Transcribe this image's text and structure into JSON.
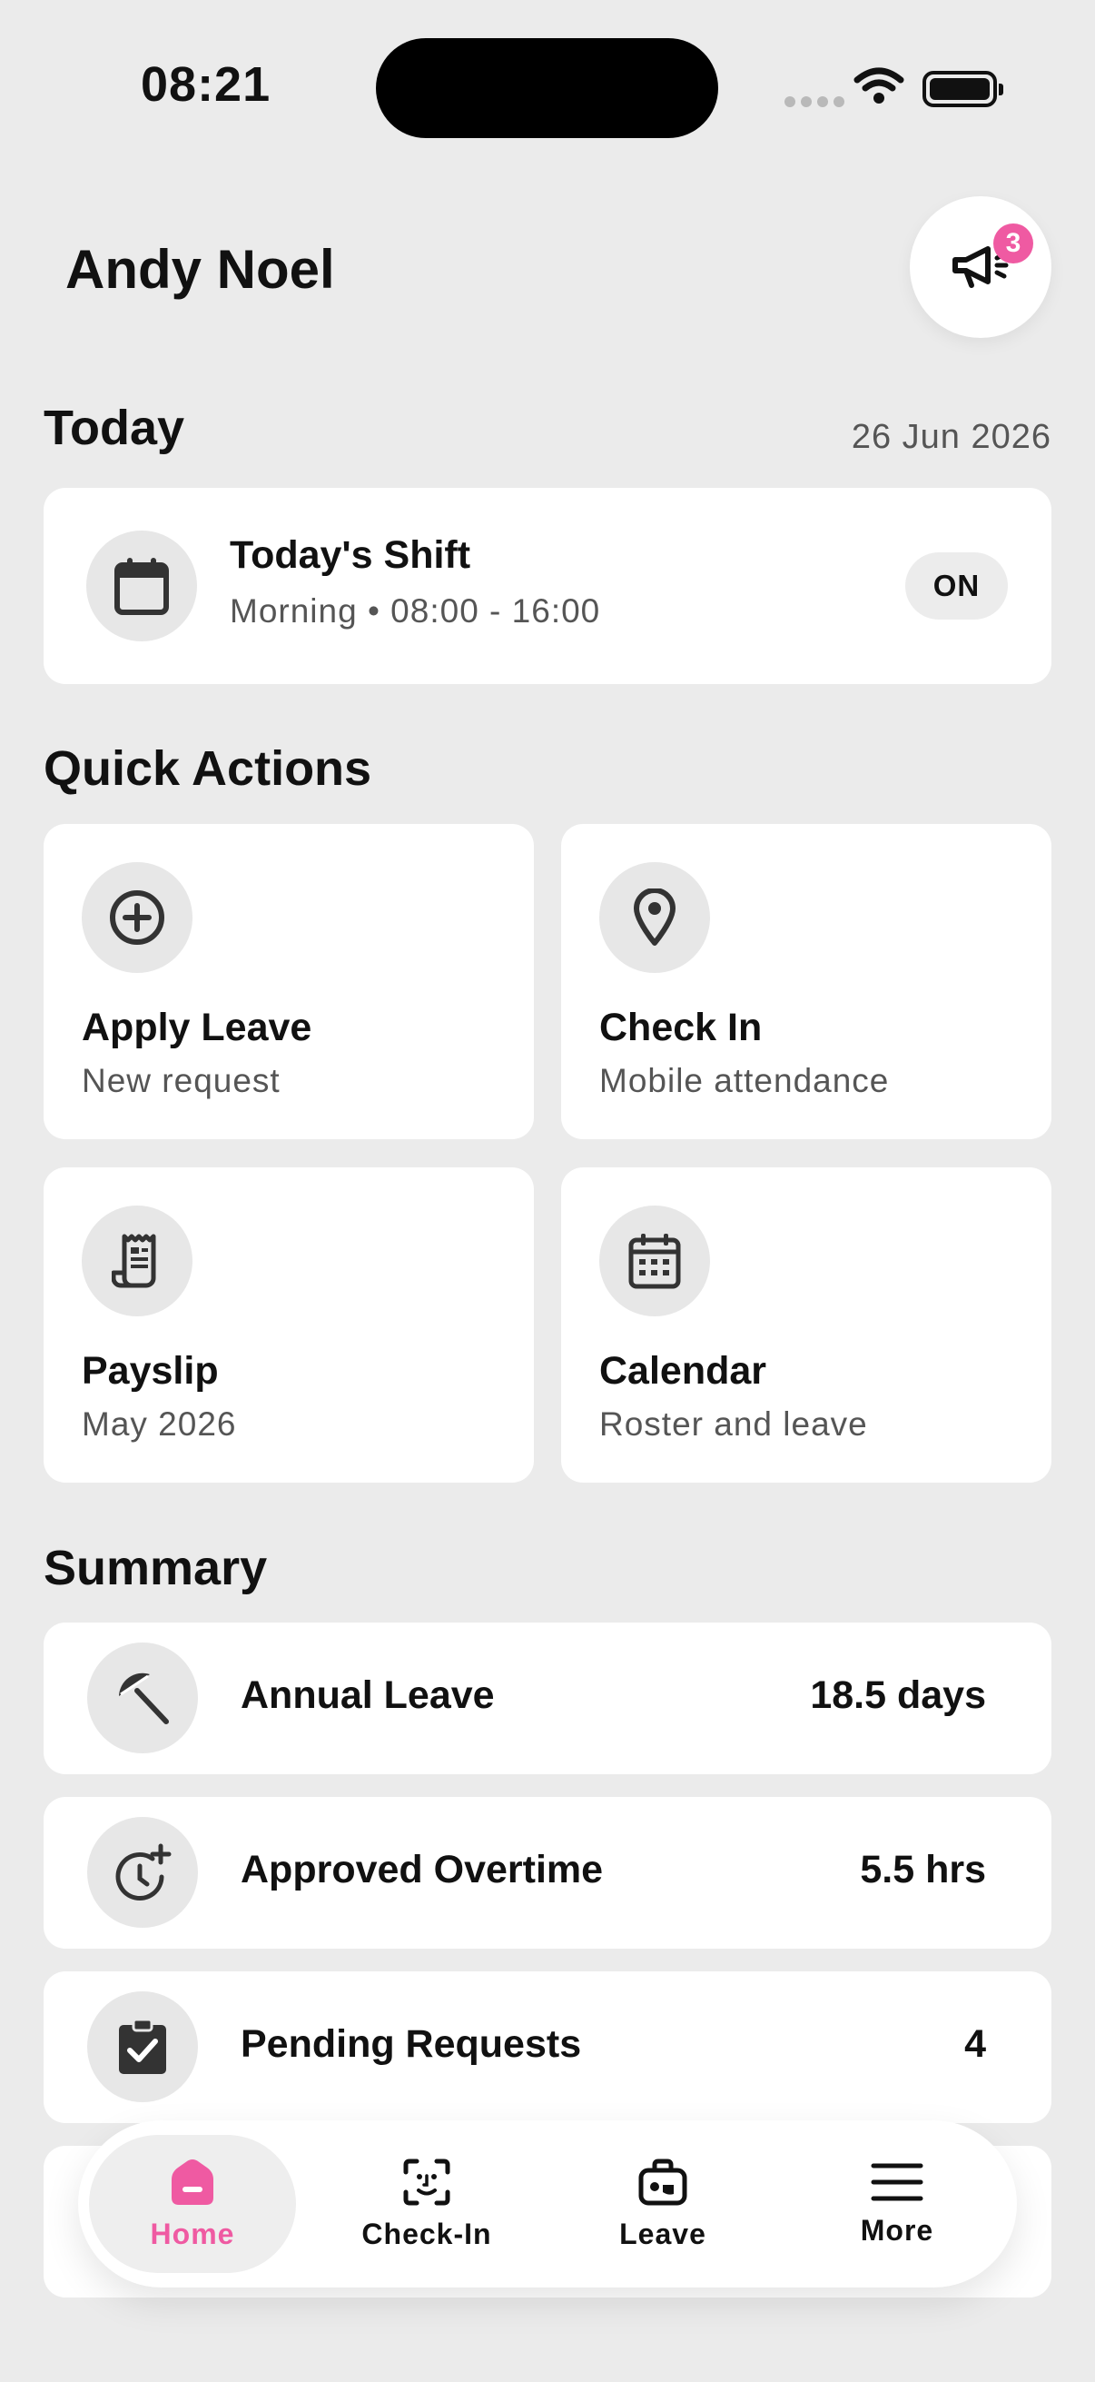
{
  "status_bar": {
    "time": "08:21"
  },
  "header": {
    "user_name": "Andy Noel",
    "notification_count": "3",
    "announce_icon": "megaphone-icon"
  },
  "today": {
    "title": "Today",
    "date": "26 Jun 2026",
    "shift": {
      "title": "Today's Shift",
      "detail": "Morning • 08:00 - 16:00",
      "status": "ON",
      "icon": "calendar-icon"
    }
  },
  "quick_actions": {
    "title": "Quick Actions",
    "items": [
      {
        "title": "Apply Leave",
        "subtitle": "New request",
        "icon": "add-circle-icon"
      },
      {
        "title": "Check In",
        "subtitle": "Mobile attendance",
        "icon": "location-pin-icon"
      },
      {
        "title": "Payslip",
        "subtitle": "May 2026",
        "icon": "receipt-icon"
      },
      {
        "title": "Calendar",
        "subtitle": "Roster and leave",
        "icon": "calendar-grid-icon"
      }
    ]
  },
  "summary": {
    "title": "Summary",
    "items": [
      {
        "label": "Annual Leave",
        "value": "18.5 days",
        "icon": "beach-umbrella-icon"
      },
      {
        "label": "Approved Overtime",
        "value": "5.5 hrs",
        "icon": "clock-plus-icon"
      },
      {
        "label": "Pending Requests",
        "value": "4",
        "icon": "clipboard-check-icon"
      }
    ]
  },
  "bottom_nav": {
    "active": "Home",
    "items": [
      {
        "label": "Home",
        "icon": "home-icon"
      },
      {
        "label": "Check-In",
        "icon": "face-scan-icon"
      },
      {
        "label": "Leave",
        "icon": "suitcase-icon"
      },
      {
        "label": "More",
        "icon": "menu-icon"
      }
    ]
  },
  "colors": {
    "background": "#ebebeb",
    "accent": "#ef5aa2",
    "card": "#ffffff",
    "icon_bg": "#e7e7e7",
    "text": "#111111",
    "muted": "#555555"
  }
}
